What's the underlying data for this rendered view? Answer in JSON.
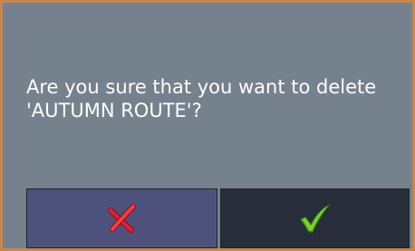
{
  "dialog": {
    "message_line1": "Are you sure that you want to delete",
    "message_line2": "'AUTUMN ROUTE'?"
  },
  "buttons": {
    "cancel": {
      "icon": "red-x-icon"
    },
    "confirm": {
      "icon": "green-check-icon"
    }
  },
  "colors": {
    "dialog_background": "#75818d",
    "border": "#c8864a",
    "cancel_button": "#4f517d",
    "confirm_button": "#272d3a",
    "text": "#ffffff"
  }
}
